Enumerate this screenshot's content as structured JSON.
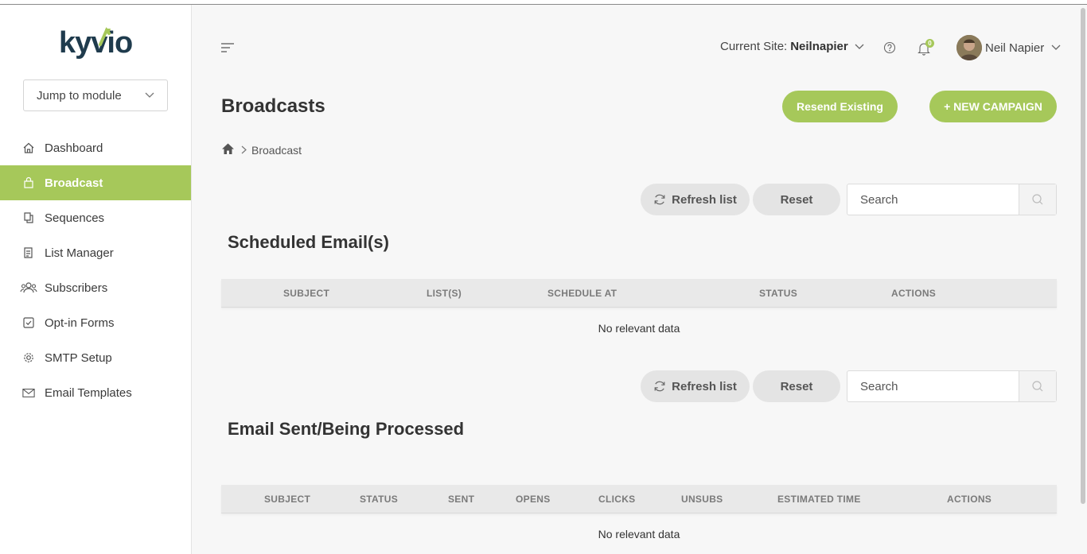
{
  "logo": {
    "text": "kyvio"
  },
  "sidebar": {
    "jump_label": "Jump to module",
    "items": [
      {
        "label": "Dashboard",
        "icon": "home-icon"
      },
      {
        "label": "Broadcast",
        "icon": "bag-icon",
        "active": true
      },
      {
        "label": "Sequences",
        "icon": "sequences-icon"
      },
      {
        "label": "List Manager",
        "icon": "list-icon"
      },
      {
        "label": "Subscribers",
        "icon": "users-icon"
      },
      {
        "label": "Opt-in Forms",
        "icon": "checkbox-icon"
      },
      {
        "label": "SMTP Setup",
        "icon": "gear-icon"
      },
      {
        "label": "Email Templates",
        "icon": "envelope-icon"
      }
    ]
  },
  "header": {
    "site_label": "Current Site:",
    "site_value": "Neilnapier",
    "notifications_count": "0",
    "user_name": "Neil Napier"
  },
  "page": {
    "title": "Broadcasts",
    "resend_label": "Resend Existing",
    "new_campaign_label": "+ NEW CAMPAIGN",
    "breadcrumb_current": "Broadcast"
  },
  "scheduled": {
    "refresh_label": "Refresh list",
    "reset_label": "Reset",
    "search_placeholder": "Search",
    "title": "Scheduled Email(s)",
    "columns": [
      "SUBJECT",
      "LIST(S)",
      "SCHEDULE AT",
      "STATUS",
      "ACTIONS"
    ],
    "empty_text": "No relevant data"
  },
  "sent": {
    "refresh_label": "Refresh list",
    "reset_label": "Reset",
    "search_placeholder": "Search",
    "title": "Email Sent/Being Processed",
    "columns": [
      "SUBJECT",
      "STATUS",
      "SENT",
      "OPENS",
      "CLICKS",
      "UNSUBS",
      "ESTIMATED TIME",
      "ACTIONS"
    ],
    "empty_text": "No relevant data"
  },
  "colors": {
    "accent": "#a6c85a",
    "logo_dark": "#1f3b4d"
  }
}
